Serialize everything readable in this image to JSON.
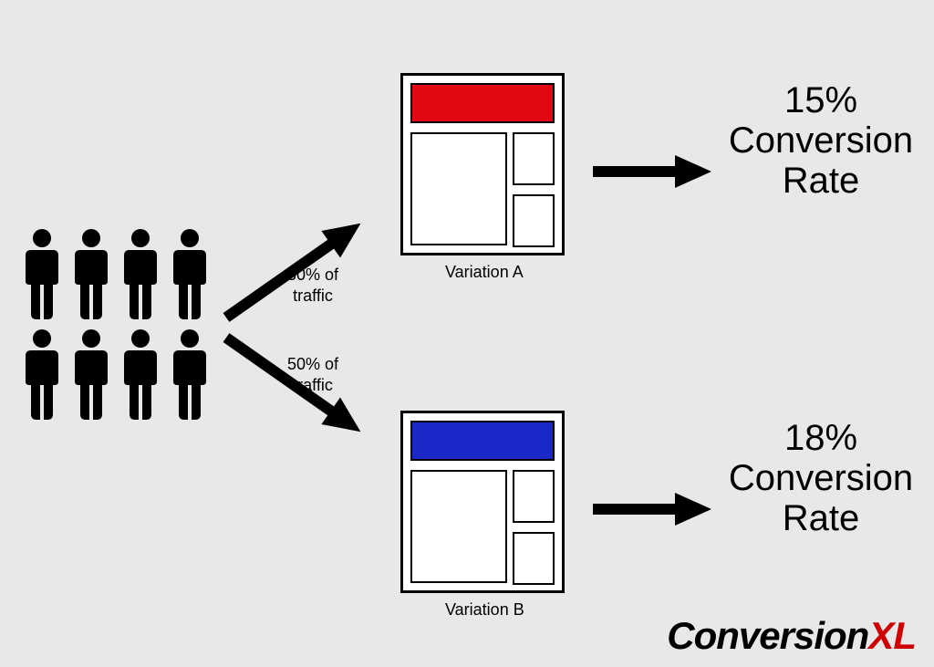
{
  "split": {
    "top_label_line1": "50% of",
    "top_label_line2": "traffic",
    "bottom_label_line1": "50% of",
    "bottom_label_line2": "traffic"
  },
  "variation_a": {
    "caption": "Variation A",
    "header_color": "#e30613",
    "result_line1": "15%",
    "result_line2": "Conversion",
    "result_line3": "Rate"
  },
  "variation_b": {
    "caption": "Variation B",
    "header_color": "#1a28c8",
    "result_line1": "18%",
    "result_line2": "Conversion",
    "result_line3": "Rate"
  },
  "brand": {
    "part1": "Conversion",
    "part2": "XL"
  }
}
